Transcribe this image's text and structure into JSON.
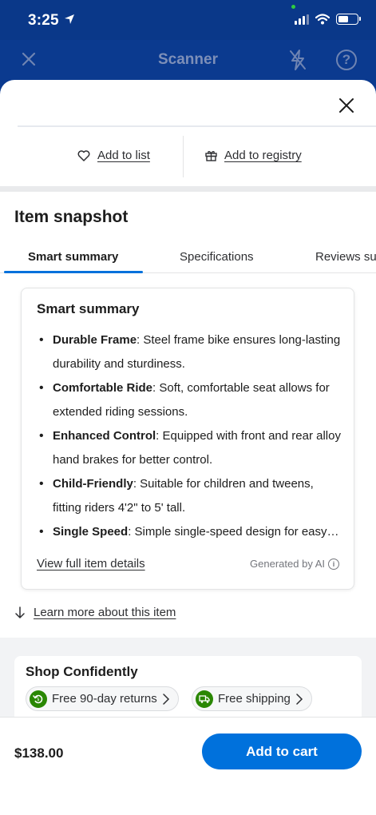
{
  "status": {
    "time": "3:25"
  },
  "scanner": {
    "title": "Scanner",
    "help_glyph": "?"
  },
  "actions": {
    "add_to_list": "Add to list",
    "add_to_registry": "Add to registry"
  },
  "snapshot": {
    "title": "Item snapshot",
    "tabs": [
      {
        "label": "Smart summary",
        "active": true
      },
      {
        "label": "Specifications",
        "active": false
      },
      {
        "label": "Reviews su",
        "active": false
      }
    ]
  },
  "summary": {
    "title": "Smart summary",
    "bullets": [
      {
        "heading": "Durable Frame",
        "text": ": Steel frame bike ensures long-lasting durability and sturdiness."
      },
      {
        "heading": "Comfortable Ride",
        "text": ": Soft, comfortable seat allows for extended riding sessions."
      },
      {
        "heading": "Enhanced Control",
        "text": ": Equipped with front and rear alloy hand brakes for better control."
      },
      {
        "heading": "Child-Friendly",
        "text": ": Suitable for children and tweens, fitting riders 4'2\" to 5' tall."
      },
      {
        "heading": "Single Speed",
        "text": ": Simple single-speed design for easy…"
      }
    ],
    "view_full": "View full item details",
    "generated": "Generated by AI",
    "info_glyph": "i"
  },
  "learn_more": "Learn more about this item",
  "shop": {
    "title": "Shop Confidently",
    "chips": [
      {
        "label": "Free 90-day returns"
      },
      {
        "label": "Free shipping"
      }
    ]
  },
  "footer": {
    "price": "$138.00",
    "add_to_cart": "Add to cart"
  },
  "colors": {
    "brand_blue": "#0071dc",
    "header_navy": "#0b3a8f",
    "green": "#2a8703"
  }
}
